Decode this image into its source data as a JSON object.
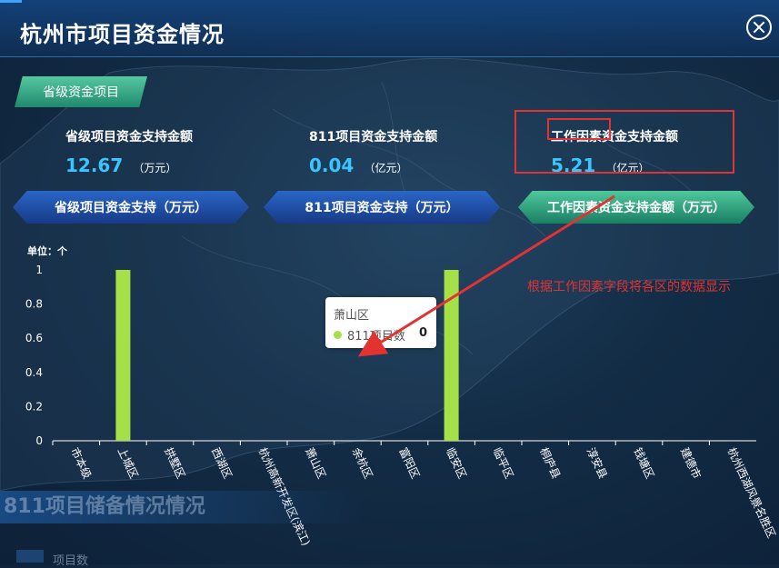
{
  "header": {
    "title": "杭州市项目资金情况"
  },
  "green_tab": {
    "label": "省级资金项目"
  },
  "metrics": [
    {
      "label": "省级项目资金支持金额",
      "value": "12.67",
      "unit": "（万元）"
    },
    {
      "label": "811项目资金支持金额",
      "value": "0.04",
      "unit": "（亿元）"
    },
    {
      "label": "工作因素资金支持金额",
      "value": "5.21",
      "unit": "（亿元）"
    }
  ],
  "sub_tabs": [
    {
      "label": "省级项目资金支持（万元）"
    },
    {
      "label": "811项目资金支持（万元）"
    },
    {
      "label": "工作因素资金支持金额（万元）"
    }
  ],
  "chart_data": {
    "type": "bar",
    "unit_label": "单位：个",
    "categories": [
      "市本级",
      "上城区",
      "拱墅区",
      "西湖区",
      "杭州高新开发区(滨江)",
      "萧山区",
      "余杭区",
      "富阳区",
      "临安区",
      "临平区",
      "桐庐县",
      "淳安县",
      "钱塘区",
      "建德市",
      "杭州西湖风景名胜区"
    ],
    "series": [
      {
        "name": "811项目数",
        "values": [
          0,
          1,
          0,
          0,
          0,
          0,
          0,
          0,
          1,
          0,
          0,
          0,
          0,
          0,
          0
        ]
      }
    ],
    "ylim": [
      0,
      1
    ],
    "yticks": [
      "0",
      "0.2",
      "0.4",
      "0.6",
      "0.8",
      "1"
    ],
    "bar_color": "#a6e048",
    "grid": false
  },
  "tooltip": {
    "title": "萧山区",
    "series": "811项目数",
    "value": "0",
    "dot_color": "#a6e048"
  },
  "annotation": {
    "text": "根据工作因素字段将各区的数据显示",
    "color": "#e23232"
  },
  "background": {
    "section_title": "811项目储备情况情况",
    "legend_label": "项目数"
  }
}
